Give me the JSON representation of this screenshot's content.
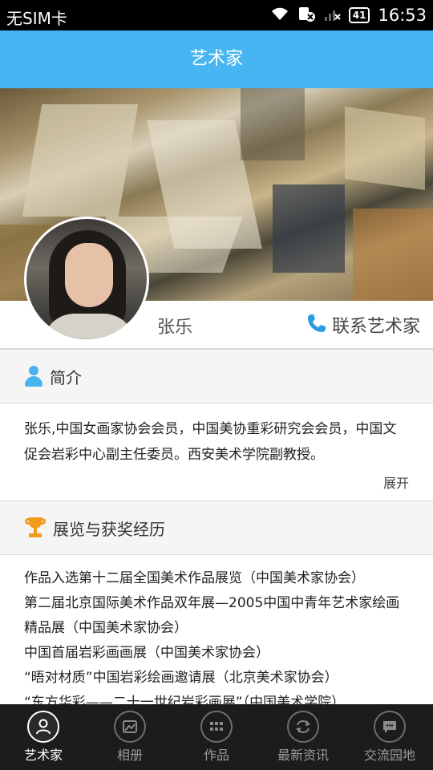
{
  "status_bar": {
    "carrier": "无SIM卡",
    "battery": "41",
    "time": "16:53"
  },
  "header": {
    "title": "艺术家"
  },
  "artist": {
    "name": "张乐",
    "contact_label": "联系艺术家"
  },
  "intro": {
    "title": "简介",
    "text": "张乐,中国女画家协会会员，中国美协重彩研究会会员，中国文促会岩彩中心副主任委员。西安美术学院副教授。",
    "expand_label": "展开"
  },
  "exhibitions": {
    "title": "展览与获奖经历",
    "items": [
      "作品入选第十二届全国美术作品展览（中国美术家协会）",
      "第二届北京国际美术作品双年展—2005中国中青年艺术家绘画精品展（中国美术家协会）",
      "中国首届岩彩画画展（中国美术家协会）",
      "“晤对材质”中国岩彩绘画邀请展（北京美术家协会）",
      "“东方华彩——二十一世纪岩彩画展”（中国美术学院）"
    ]
  },
  "tabs": [
    {
      "label": "艺术家",
      "icon": "person-icon",
      "active": true
    },
    {
      "label": "相册",
      "icon": "album-icon",
      "active": false
    },
    {
      "label": "作品",
      "icon": "grid-icon",
      "active": false
    },
    {
      "label": "最新资讯",
      "icon": "refresh-icon",
      "active": false
    },
    {
      "label": "交流园地",
      "icon": "chat-icon",
      "active": false
    }
  ],
  "colors": {
    "accent": "#47b5f1",
    "tab_bar": "#1c1c1c",
    "trophy": "#f39b1c"
  }
}
